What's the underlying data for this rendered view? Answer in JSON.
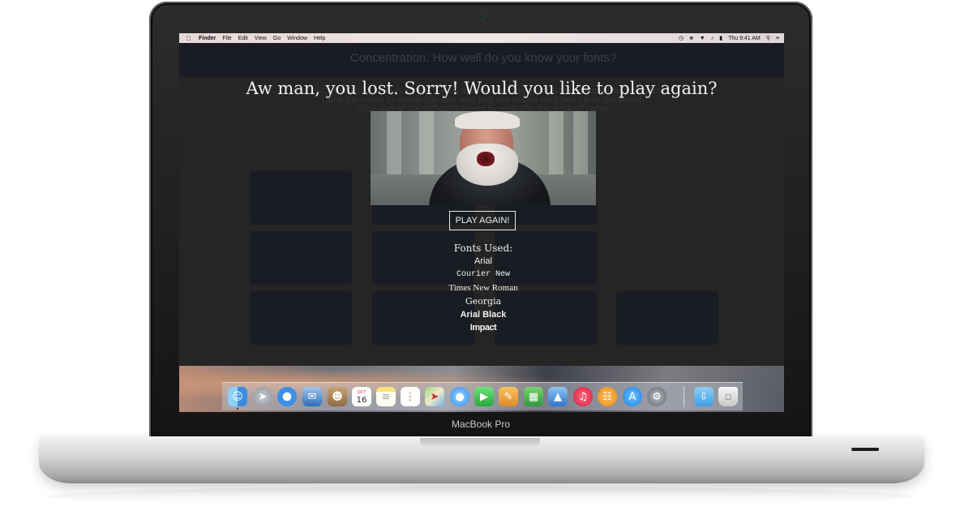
{
  "device": {
    "label": "MacBook Pro"
  },
  "menubar": {
    "app_name": "Finder",
    "items": [
      "File",
      "Edit",
      "View",
      "Go",
      "Window",
      "Help"
    ],
    "clock": "Thu 9:41 AM",
    "status_icons": [
      "time-machine-icon",
      "bluetooth-icon",
      "wifi-icon",
      "volume-icon",
      "battery-icon",
      "spotlight-icon",
      "notification-center-icon"
    ]
  },
  "game": {
    "title": "Concentration: How well do you know your fonts?",
    "instructions": [
      "Select a difficulty level (you will not be able to play the game until making this selection).",
      "Click the cards to reveal the font and find the match until you clear the board.",
      "Click one of the difficulty levels to reshuffle the deck of cards."
    ]
  },
  "modal": {
    "message": "Aw man, you lost. Sorry! Would you like to play again?",
    "play_again_label": "PLAY AGAIN!",
    "fonts_used_label": "Fonts Used:",
    "fonts": [
      "Arial",
      "Courier New",
      "Times New Roman",
      "Georgia",
      "Arial Black",
      "Impact"
    ]
  },
  "dock": {
    "apps": [
      "finder-icon",
      "launchpad-icon",
      "safari-icon",
      "mail-icon",
      "contacts-icon",
      "calendar-icon",
      "notes-icon",
      "reminders-icon",
      "maps-icon",
      "messages-icon",
      "facetime-icon",
      "pages-icon",
      "numbers-icon",
      "keynote-icon",
      "music-icon",
      "ibooks-icon",
      "app-store-icon",
      "system-preferences-icon",
      "downloads-folder-icon",
      "trash-icon"
    ],
    "calendar_day": "16",
    "calendar_month": "OCT"
  },
  "colors": {
    "page_background": "#252525",
    "card_color": "#1a1c24",
    "text_light": "#f1f1f1"
  }
}
